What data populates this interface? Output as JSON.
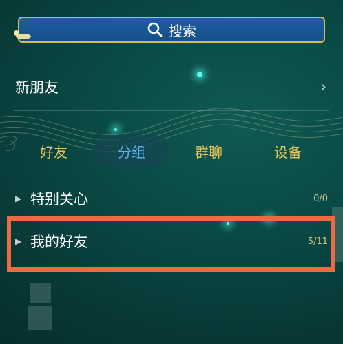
{
  "search": {
    "label": "搜索",
    "icon": "search-icon"
  },
  "new_friends": {
    "label": "新朋友",
    "chevron": "›"
  },
  "tabs": [
    {
      "label": "好友",
      "active": false
    },
    {
      "label": "分组",
      "active": true
    },
    {
      "label": "群聊",
      "active": false
    },
    {
      "label": "设备",
      "active": false
    }
  ],
  "groups": [
    {
      "name": "特别关心",
      "count": "0/0"
    },
    {
      "name": "我的好友",
      "count": "5/11",
      "highlighted": true
    }
  ],
  "colors": {
    "tab_inactive": "#e5c55a",
    "tab_active": "#5ab3f2",
    "highlight": "#ee6a40",
    "search_bg": "#1c5ea0",
    "search_border": "#d8b75a"
  }
}
